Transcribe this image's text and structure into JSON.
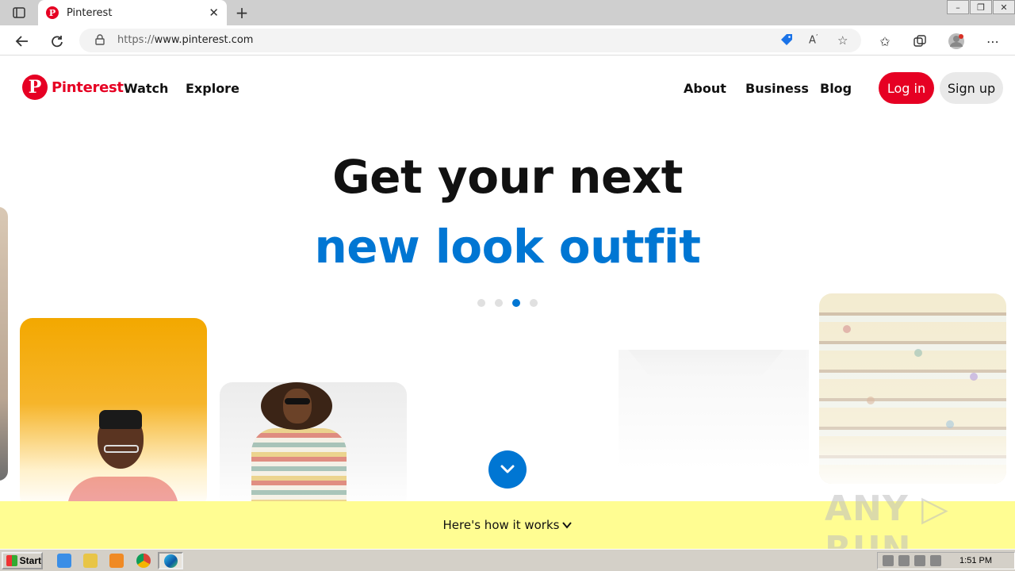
{
  "browser": {
    "tab_title": "Pinterest",
    "tab_close": "✕",
    "new_tab": "+",
    "window_controls": [
      "–",
      "❐",
      "✕"
    ],
    "url_scheme": "https://",
    "url_host": "www.pinterest.com"
  },
  "site": {
    "logo_letter": "P",
    "logo_text": "Pinterest",
    "nav_left": [
      "Watch",
      "Explore"
    ],
    "nav_right": [
      "About",
      "Business",
      "Blog"
    ],
    "login_label": "Log in",
    "signup_label": "Sign up"
  },
  "hero": {
    "line1": "Get your next",
    "line2": "new look outfit",
    "active_dot": 3,
    "dot_count": 4
  },
  "how_it_works": "Here's how it works",
  "watermark": "ANY ▷ RUN",
  "taskbar": {
    "start_label": "Start",
    "clock": "1:51 PM"
  },
  "colors": {
    "brand_red": "#e60023",
    "accent_blue": "#0076d3",
    "banner_yellow": "#fffd92"
  }
}
